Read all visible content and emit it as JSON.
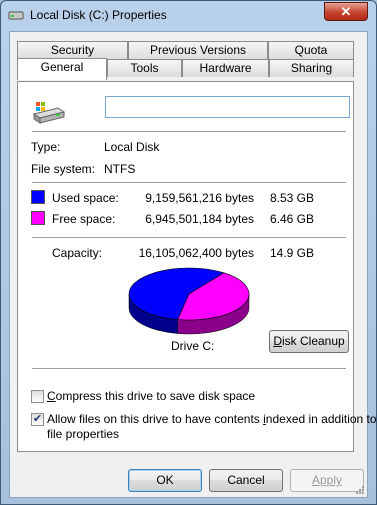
{
  "window": {
    "title": "Local Disk (C:) Properties",
    "close_glyph": "✕"
  },
  "tabs": {
    "row_back": [
      "Security",
      "Previous Versions",
      "Quota"
    ],
    "row_front": [
      "General",
      "Tools",
      "Hardware",
      "Sharing"
    ],
    "active": "General"
  },
  "general": {
    "volume_name_value": "",
    "type_label": "Type:",
    "type_value": "Local Disk",
    "fs_label": "File system:",
    "fs_value": "NTFS",
    "used_label": "Used space:",
    "used_bytes": "9,159,561,216 bytes",
    "used_size": "8.53 GB",
    "free_label": "Free space:",
    "free_bytes": "6,945,501,184 bytes",
    "free_size": "6.46 GB",
    "capacity_label": "Capacity:",
    "capacity_bytes": "16,105,062,400 bytes",
    "capacity_size": "14.9 GB",
    "drive_label": "Drive C:",
    "disk_cleanup_prefix": "",
    "disk_cleanup_mnemonic": "D",
    "disk_cleanup_rest": "isk Cleanup",
    "compress_pre": "",
    "compress_mnemonic": "C",
    "compress_rest": "ompress this drive to save disk space",
    "compress_checked": false,
    "index_pre": "Allow files on this drive to have contents ",
    "index_mnemonic": "i",
    "index_rest": "ndexed in addition to",
    "index_line2": "file properties",
    "index_checked": true
  },
  "colors": {
    "used": "#0000ff",
    "free": "#ff00ff"
  },
  "chart_data": {
    "type": "pie",
    "categories": [
      "Used space",
      "Free space"
    ],
    "values": [
      9159561216,
      6945501184
    ]
  },
  "buttons": {
    "ok": "OK",
    "cancel": "Cancel",
    "apply": "Apply"
  }
}
